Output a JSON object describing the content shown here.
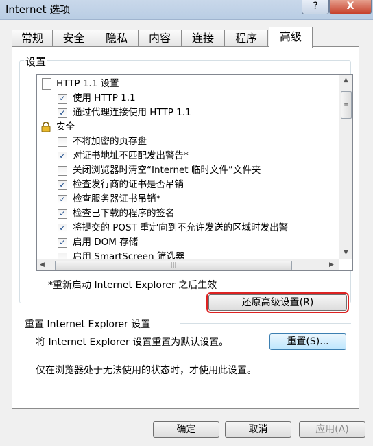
{
  "window": {
    "title": "Internet 选项",
    "help_label": "?",
    "close_label": "X"
  },
  "tabs": [
    "常规",
    "安全",
    "隐私",
    "内容",
    "连接",
    "程序",
    "高级"
  ],
  "active_tab": "高级",
  "settings": {
    "legend": "设置",
    "items": [
      {
        "type": "heading",
        "icon": "page-icon",
        "label": "HTTP 1.1 设置"
      },
      {
        "type": "checkbox",
        "checked": true,
        "label": "使用 HTTP 1.1"
      },
      {
        "type": "checkbox",
        "checked": true,
        "label": "通过代理连接使用 HTTP 1.1"
      },
      {
        "type": "heading",
        "icon": "lock-icon",
        "label": "安全"
      },
      {
        "type": "checkbox",
        "checked": false,
        "label": "不将加密的页存盘"
      },
      {
        "type": "checkbox",
        "checked": true,
        "label": "对证书地址不匹配发出警告*"
      },
      {
        "type": "checkbox",
        "checked": false,
        "label": "关闭浏览器时清空“Internet 临时文件”文件夹"
      },
      {
        "type": "checkbox",
        "checked": true,
        "label": "检查发行商的证书是否吊销"
      },
      {
        "type": "checkbox",
        "checked": true,
        "label": "检查服务器证书吊销*"
      },
      {
        "type": "checkbox",
        "checked": true,
        "label": "检查已下载的程序的签名"
      },
      {
        "type": "checkbox",
        "checked": true,
        "label": "将提交的 POST 重定向到不允许发送的区域时发出警"
      },
      {
        "type": "checkbox",
        "checked": true,
        "label": "启用 DOM 存储"
      },
      {
        "type": "checkbox",
        "checked": false,
        "label": "启用 SmartScreen 筛选器"
      }
    ],
    "restart_note": "*重新启动 Internet Explorer 之后生效",
    "restore_button": "还原高级设置(R)"
  },
  "reset": {
    "title": "重置 Internet Explorer 设置",
    "description": "将 Internet Explorer 设置重置为默认设置。",
    "button": "重置(S)...",
    "note": "仅在浏览器处于无法使用的状态时，才使用此设置。"
  },
  "footer": {
    "ok": "确定",
    "cancel": "取消",
    "apply": "应用(A)"
  },
  "colors": {
    "highlight_outline": "#dd2222",
    "title_bar": "#c9d8ea"
  }
}
